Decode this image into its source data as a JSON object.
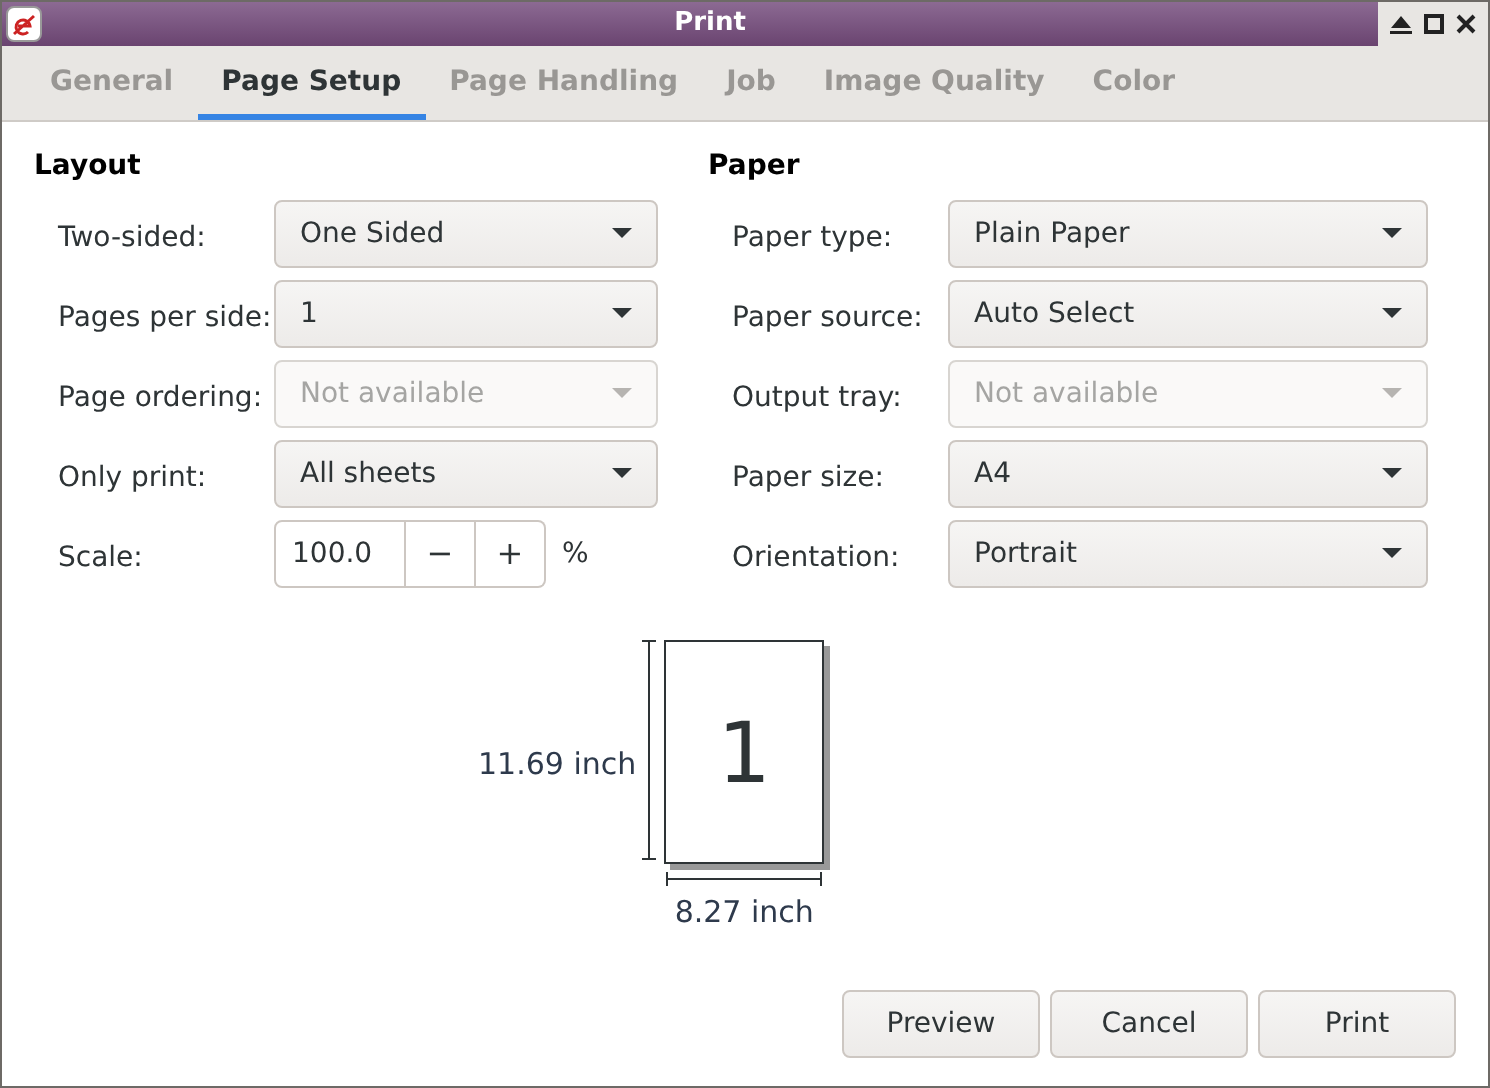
{
  "window": {
    "title": "Print"
  },
  "tabs": [
    {
      "label": "General",
      "selected": false
    },
    {
      "label": "Page Setup",
      "selected": true
    },
    {
      "label": "Page Handling",
      "selected": false
    },
    {
      "label": "Job",
      "selected": false
    },
    {
      "label": "Image Quality",
      "selected": false
    },
    {
      "label": "Color",
      "selected": false
    }
  ],
  "sections": [
    {
      "title": "Layout",
      "rows": [
        {
          "kind": "dropdown",
          "label": "Two-sided:",
          "value": "One Sided",
          "disabled": false
        },
        {
          "kind": "dropdown",
          "label": "Pages per side:",
          "value": "1",
          "disabled": false
        },
        {
          "kind": "dropdown",
          "label": "Page ordering:",
          "value": "Not available",
          "disabled": true
        },
        {
          "kind": "dropdown",
          "label": "Only print:",
          "value": "All sheets",
          "disabled": false
        },
        {
          "kind": "spin",
          "label": "Scale:",
          "value": "100.0",
          "minus": "−",
          "plus": "+",
          "unit": "%"
        }
      ]
    },
    {
      "title": "Paper",
      "rows": [
        {
          "kind": "dropdown",
          "label": "Paper type:",
          "value": "Plain Paper",
          "disabled": false
        },
        {
          "kind": "dropdown",
          "label": "Paper source:",
          "value": "Auto Select",
          "disabled": false
        },
        {
          "kind": "dropdown",
          "label": "Output tray:",
          "value": "Not available",
          "disabled": true
        },
        {
          "kind": "dropdown",
          "label": "Paper size:",
          "value": "A4",
          "disabled": false
        },
        {
          "kind": "dropdown",
          "label": "Orientation:",
          "value": "Portrait",
          "disabled": false
        }
      ]
    }
  ],
  "preview": {
    "page_number": "1",
    "height": "11.69 inch",
    "width": "8.27 inch"
  },
  "buttons": [
    "Preview",
    "Cancel",
    "Print"
  ]
}
